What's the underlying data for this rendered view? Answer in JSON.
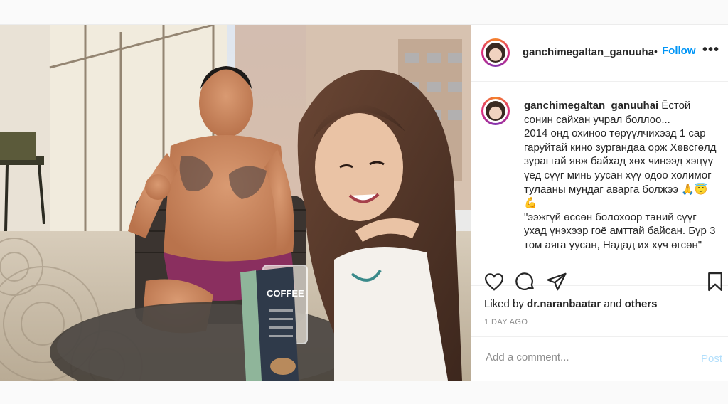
{
  "post": {
    "username": "ganchimegaltan_ganuuha",
    "separator": "•",
    "follow_label": "Follow",
    "more_label": "•••"
  },
  "caption": {
    "username": "ganchimegaltan_ganuuhai",
    "text": " Ёстой сонин сайхан учрал боллоо...\n2014 онд охиноо төрүүлчихээд 1 сар гаруйтай кино зургандаа орж Хөвсгөлд зурагтай явж байхад хөх чинээд хэцүү үед сүүг минь уусан хүү одоо холимог тулааны мундаг аварга болжээ 🙏😇💪\n\"ээжгүй өссөн болохоор таний сүүг ухад үнэхээр гоё амттай байсан. Бүр 3 том аяга уусан, Надад их хүч өгсөн\" "
  },
  "likes": {
    "prefix": "Liked by ",
    "user": "dr.naranbaatar",
    "middle": " and ",
    "others": "others"
  },
  "timestamp": "1 DAY AGO",
  "comment": {
    "placeholder": "Add a comment...",
    "post_label": "Post"
  },
  "photo": {
    "cup_label": "COFFEE"
  },
  "icons": {
    "like": "heart-icon",
    "comment": "comment-icon",
    "share": "share-icon",
    "save": "bookmark-icon"
  },
  "colors": {
    "follow": "#0095f6",
    "post_disabled": "#b2dffc",
    "muted": "#8e8e8e"
  }
}
